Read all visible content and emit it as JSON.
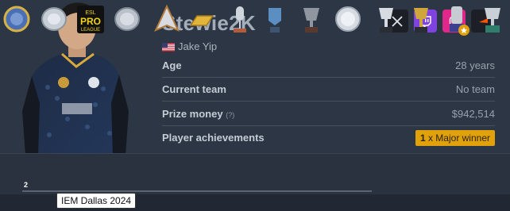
{
  "player": {
    "nickname": "Stewie2K",
    "real_name": "Jake Yip",
    "flag_icon": "us-flag-icon"
  },
  "socials": [
    {
      "name": "x-social-button",
      "icon": "x-icon",
      "color": "#1a1a1a"
    },
    {
      "name": "twitch-social-button",
      "icon": "twitch-icon",
      "color": "#7e43e0"
    },
    {
      "name": "instagram-social-button",
      "icon": "instagram-icon",
      "color": "#e0288b"
    },
    {
      "name": "faceit-social-button",
      "icon": "faceit-icon",
      "color": "#1a1a1a"
    }
  ],
  "stats": {
    "age_label": "Age",
    "age_value": "28 years",
    "team_label": "Current team",
    "team_value": "No team",
    "prize_label": "Prize money",
    "prize_help": "(?)",
    "prize_value": "$942,514",
    "achievements_label": "Player achievements",
    "major_count": "1",
    "major_text": "x Major winner"
  },
  "trophies": {
    "first_count": "2",
    "tooltip": "IEM Dallas 2024",
    "items": [
      "gold-ring-trophy-icon",
      "silver-plate-trophy-icon",
      "esl-pro-league-trophy-icon",
      "silver-plate-trophy-icon",
      "blast-trophy-icon",
      "gold-bar-trophy-icon",
      "microphone-trophy-icon",
      "blue-trophy-icon",
      "dark-cup-trophy-icon",
      "silver-plate-trophy-icon",
      "silver-cup-trophy-icon",
      "gold-cup-trophy-icon",
      "iem-trophy-icon",
      "cup-with-stand-trophy-icon"
    ]
  },
  "colors": {
    "background": "#2d3644",
    "accent_major": "#e0a10b",
    "twitch": "#7e43e0",
    "instagram": "#e0288b"
  }
}
